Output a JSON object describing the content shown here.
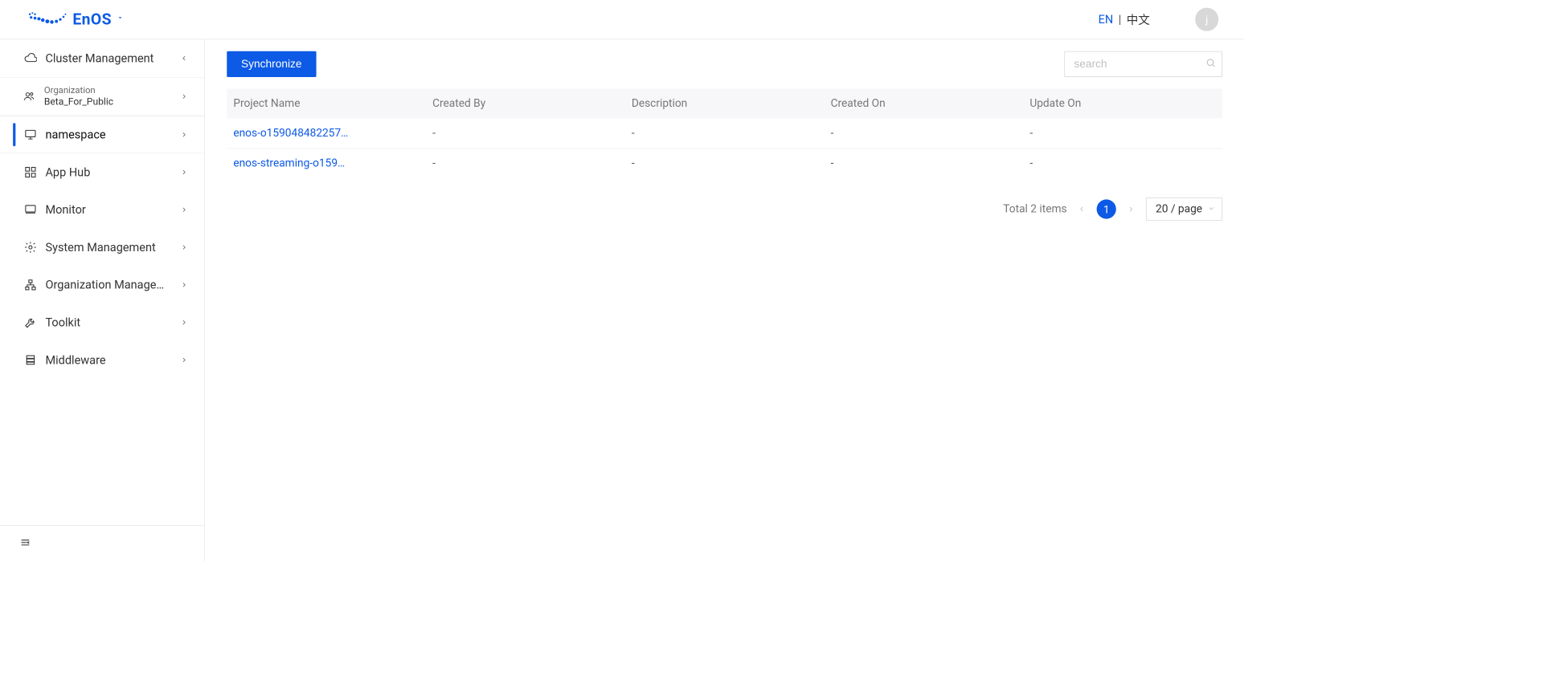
{
  "brand": {
    "name": "EnOS",
    "tm": "™"
  },
  "header": {
    "lang_en": "EN",
    "lang_divider": "|",
    "lang_zh": "中文",
    "avatar_initial": "j"
  },
  "sidebar": {
    "cluster_mgmt": "Cluster Management",
    "org_label": "Organization",
    "org_value": "Beta_For_Public",
    "namespace": "namespace",
    "items": [
      {
        "label": "App Hub"
      },
      {
        "label": "Monitor"
      },
      {
        "label": "System Management"
      },
      {
        "label": "Organization Manage…"
      },
      {
        "label": "Toolkit"
      },
      {
        "label": "Middleware"
      }
    ]
  },
  "toolbar": {
    "sync_label": "Synchronize",
    "search_placeholder": "search"
  },
  "table": {
    "headers": {
      "project_name": "Project Name",
      "created_by": "Created By",
      "description": "Description",
      "created_on": "Created On",
      "update_on": "Update On"
    },
    "rows": [
      {
        "project_name": "enos-o159048482257…",
        "created_by": "-",
        "description": "-",
        "created_on": "-",
        "update_on": "-"
      },
      {
        "project_name": "enos-streaming-o159…",
        "created_by": "-",
        "description": "-",
        "created_on": "-",
        "update_on": "-"
      }
    ]
  },
  "pager": {
    "total_label": "Total 2 items",
    "current_page": "1",
    "page_size_label": "20 / page"
  }
}
